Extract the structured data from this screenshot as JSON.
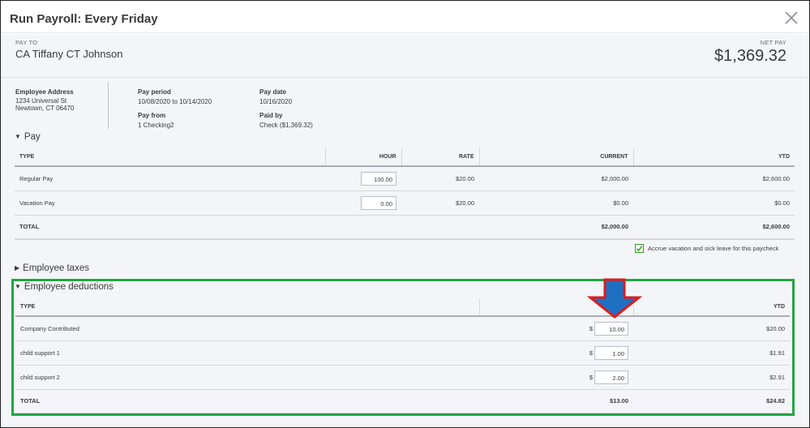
{
  "dialog": {
    "title": "Run Payroll: Every Friday"
  },
  "pay_to": {
    "label": "PAY TO",
    "name": "CA Tiffany CT Johnson"
  },
  "net_pay": {
    "label": "NET PAY",
    "amount": "$1,369.32"
  },
  "employee_address": {
    "label": "Employee Address",
    "line1": "1234 Universal St",
    "line2": "Newtown, CT 06470"
  },
  "pay_period": {
    "label": "Pay period",
    "value": "10/08/2020 to 10/14/2020"
  },
  "pay_from": {
    "label": "Pay from",
    "value": "1 Checking2"
  },
  "pay_date": {
    "label": "Pay date",
    "value": "10/16/2020"
  },
  "paid_by": {
    "label": "Paid by",
    "value": "Check ($1,369.32)"
  },
  "pay_section": {
    "title": "Pay",
    "columns": {
      "type": "TYPE",
      "hour": "HOUR",
      "rate": "RATE",
      "current": "CURRENT",
      "ytd": "YTD"
    },
    "rows": [
      {
        "type": "Regular Pay",
        "hour": "100.00",
        "rate": "$20.00",
        "current": "$2,000.00",
        "ytd": "$2,600.00"
      },
      {
        "type": "Vacation Pay",
        "hour": "0.00",
        "rate": "$20.00",
        "current": "$0.00",
        "ytd": "$0.00"
      }
    ],
    "total": {
      "label": "TOTAL",
      "current": "$2,000.00",
      "ytd": "$2,600.00"
    },
    "accrue_label": "Accrue vacation and sick leave for this paycheck"
  },
  "employee_taxes": {
    "title": "Employee taxes"
  },
  "employee_deductions": {
    "title": "Employee deductions",
    "columns": {
      "type": "TYPE",
      "ytd": "YTD"
    },
    "rows": [
      {
        "type": "Company Contributed",
        "dollar": "$",
        "current": "10.00",
        "ytd": "$20.00"
      },
      {
        "type": "child support 1",
        "dollar": "$",
        "current": "1.00",
        "ytd": "$1.91"
      },
      {
        "type": "child support 2",
        "dollar": "$",
        "current": "2.00",
        "ytd": "$2.91"
      }
    ],
    "total": {
      "label": "TOTAL",
      "current": "$13.00",
      "ytd": "$24.82"
    }
  },
  "colors": {
    "highlight_box": "#21a642",
    "arrow_fill": "#1f6fc2",
    "arrow_outline": "#e01b1b",
    "checkbox": "#2ca01c"
  }
}
